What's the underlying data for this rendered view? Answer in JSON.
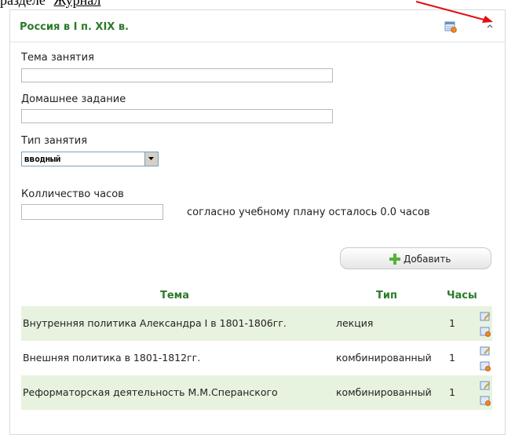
{
  "top_fragment": {
    "text": "разделе",
    "link": "Журнал"
  },
  "panel": {
    "title": "Россия в I п. XIX в.",
    "collapse_icon": "chevron-up-icon",
    "header_icon": "calendar-settings-icon"
  },
  "form": {
    "topic_label": "Тема занятия",
    "topic_value": "",
    "homework_label": "Домашнее задание",
    "homework_value": "",
    "type_label": "Тип занятия",
    "type_selected": "вводный",
    "hours_label": "Колличество часов",
    "hours_value": "",
    "hours_note": "согласно учебному плану осталось 0.0 часов",
    "add_button": "Добавить"
  },
  "table": {
    "headers": [
      "Тема",
      "Тип",
      "Часы"
    ],
    "rows": [
      {
        "topic": "Внутренняя политика Александра I в 1801-1806гг.",
        "type": "лекция",
        "hours": "1"
      },
      {
        "topic": "Внешняя политика в 1801-1812гг.",
        "type": "комбинированный",
        "hours": "1"
      },
      {
        "topic": "Реформаторская деятельность М.М.Сперанского",
        "type": "комбинированный",
        "hours": "1"
      }
    ]
  },
  "colors": {
    "accent_green": "#2b7a2b",
    "row_shade": "#e8f3df",
    "arrow_red": "#e01010"
  }
}
